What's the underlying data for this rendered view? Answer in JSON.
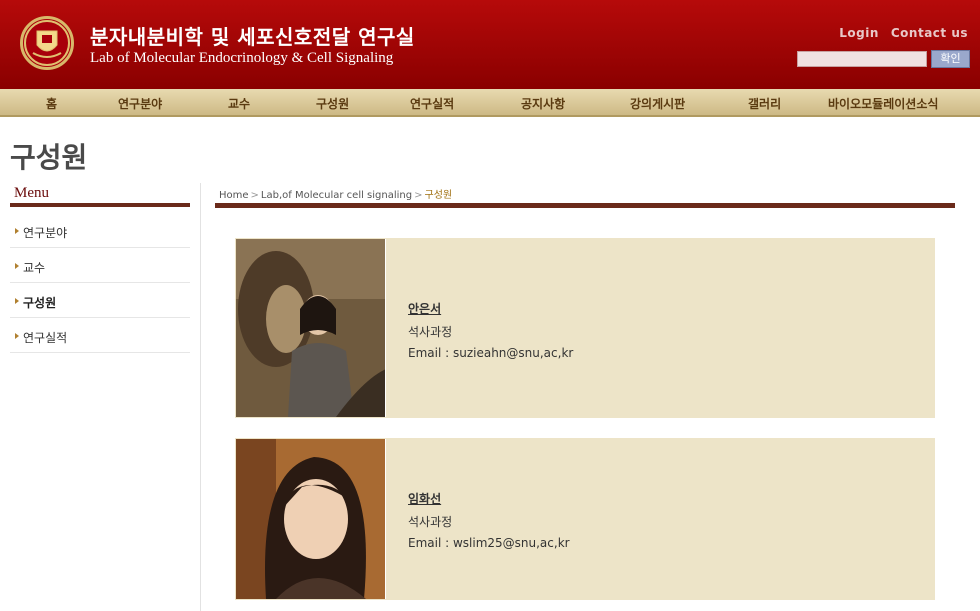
{
  "header": {
    "title_ko": "분자내분비학 및 세포신호전달 연구실",
    "title_en": "Lab of Molecular Endocrinology & Cell Signaling",
    "login": "Login",
    "contact": "Contact us",
    "search_button": "확인",
    "search_value": ""
  },
  "nav": [
    "홈",
    "연구분야",
    "교수",
    "구성원",
    "연구실적",
    "공지사항",
    "강의게시판",
    "갤러리",
    "바이오모듈레이션소식"
  ],
  "page_title": "구성원",
  "sidebar": {
    "heading": "Menu",
    "items": [
      {
        "label": "연구분야",
        "active": false
      },
      {
        "label": "교수",
        "active": false
      },
      {
        "label": "구성원",
        "active": true
      },
      {
        "label": "연구실적",
        "active": false
      }
    ]
  },
  "breadcrumb": [
    "Home",
    "Lab,of Molecular cell signaling",
    "구성원"
  ],
  "members": [
    {
      "name": "안은서",
      "role": "석사과정",
      "email": "Email : suzieahn@snu,ac,kr"
    },
    {
      "name": "임화선",
      "role": "석사과정",
      "email": "Email : wslim25@snu,ac,kr"
    }
  ],
  "colors": {
    "header": "#9e0000",
    "nav": "#d9c89a",
    "accent_line": "#6a2a1a",
    "card": "#ede4c8"
  }
}
